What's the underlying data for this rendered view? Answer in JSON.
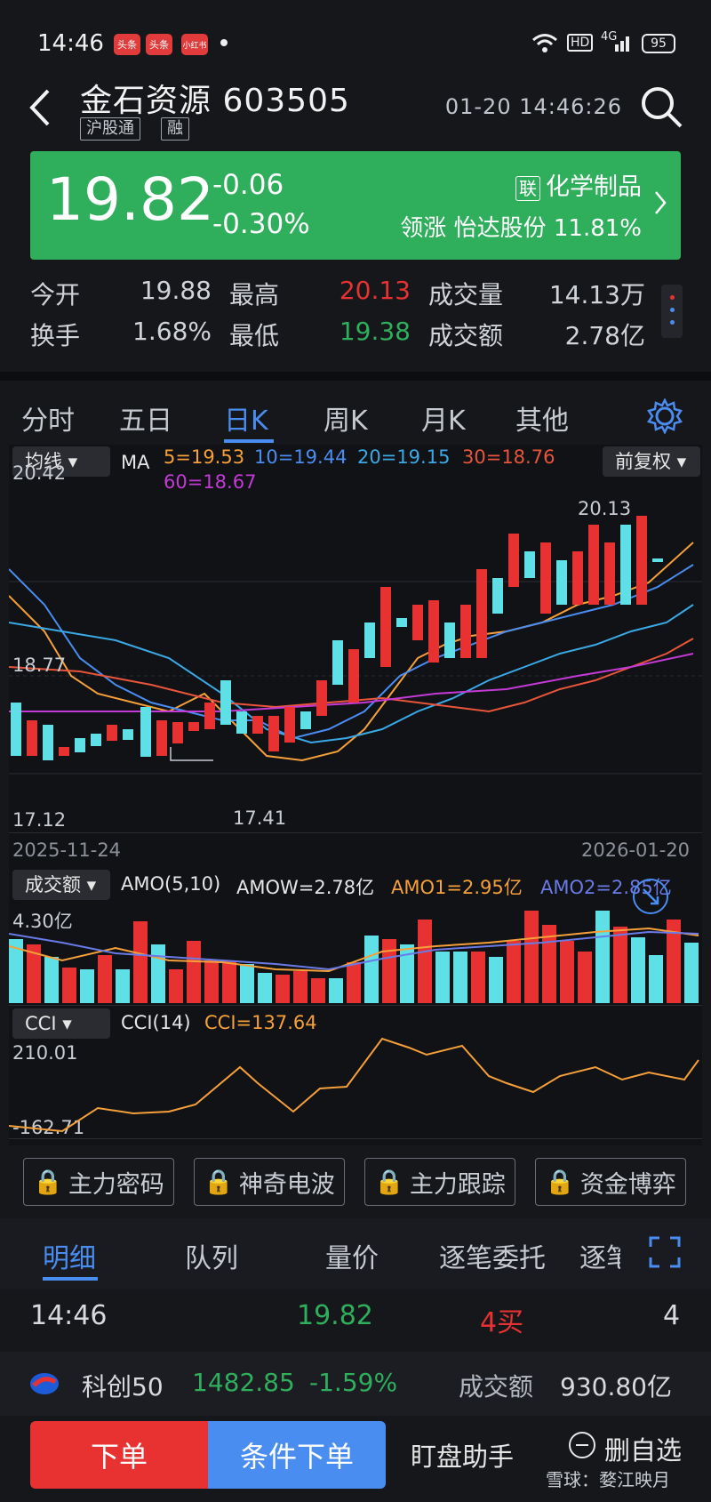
{
  "status": {
    "time": "14:46",
    "apps": [
      "头条",
      "头条",
      "小红书"
    ],
    "hd": "HD",
    "net": "4G",
    "battery": "95"
  },
  "header": {
    "name": "金石资源",
    "code": "603505",
    "tags": [
      "沪股通",
      "融"
    ],
    "datetime": "01-20  14:46:26"
  },
  "quote": {
    "price": "19.82",
    "change": "-0.06",
    "change_pct": "-0.30%",
    "sector_tag": "联",
    "sector": "化学制品",
    "leader_label": "领涨",
    "leader": "怡达股份",
    "leader_pct": "11.81%"
  },
  "stats": [
    {
      "label": "今开",
      "value": "19.88",
      "label2": "最高",
      "value2": "20.13",
      "label3": "成交量",
      "value3": "14.13万"
    },
    {
      "label": "换手",
      "value": "1.68%",
      "label2": "最低",
      "value2": "19.38",
      "label3": "成交额",
      "value3": "2.78亿"
    }
  ],
  "tabs": [
    "分时",
    "五日",
    "日K",
    "周K",
    "月K",
    "其他"
  ],
  "kline": {
    "select": "均线",
    "ma_title": "MA",
    "ma5": "5=19.53",
    "ma10": "10=19.44",
    "ma20": "20=19.15",
    "ma30": "30=18.76",
    "ma60": "60=18.67",
    "adjust": "前复权",
    "y_top": "20.42",
    "y_mid": "18.77",
    "y_bot": "17.12",
    "low_mark": "17.41",
    "high_mark": "20.13",
    "date_start": "2025-11-24",
    "date_end": "2026-01-20"
  },
  "amo": {
    "select": "成交额",
    "title": "AMO(5,10)",
    "amow": "AMOW=2.78亿",
    "amo1": "AMO1=2.95亿",
    "amo2": "AMO2=2.85亿",
    "y_top": "4.30亿"
  },
  "cci": {
    "select": "CCI",
    "title": "CCI(14)",
    "value": "CCI=137.64",
    "y_top": "210.01",
    "y_bot": "-162.71"
  },
  "tool_buttons": [
    "主力密码",
    "神奇电波",
    "主力跟踪",
    "资金博弈"
  ],
  "sub_tabs": [
    "明细",
    "队列",
    "量价",
    "逐笔委托",
    "逐笔"
  ],
  "detail": {
    "time": "14:46",
    "price": "19.82",
    "side": "4买",
    "count": "4"
  },
  "index_bar": {
    "name": "科创50",
    "value": "1482.85",
    "pct": "-1.59%",
    "amount_label": "成交额",
    "amount": "930.80亿"
  },
  "actions": {
    "order": "下单",
    "cond_order": "条件下单",
    "helper": "盯盘助手",
    "remove": "删自选",
    "watermark": "雪球：婺江映月"
  },
  "colors": {
    "up": "#e83232",
    "down": "#2fae5c",
    "accent": "#4a8df0"
  }
}
